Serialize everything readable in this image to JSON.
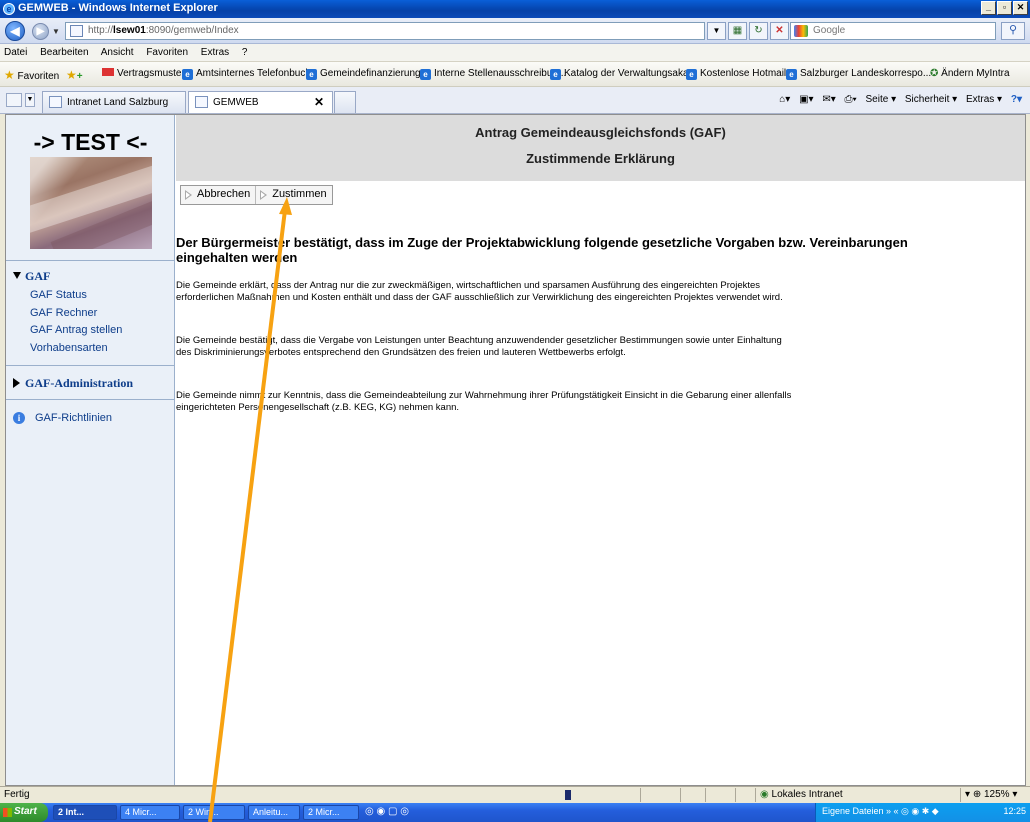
{
  "window": {
    "title": "GEMWEB - Windows Internet Explorer"
  },
  "address": {
    "url_prefix": "http://",
    "url_host": "lsew01",
    "url_rest": ":8090/gemweb/Index",
    "search_placeholder": "Google"
  },
  "menu": [
    "Datei",
    "Bearbeiten",
    "Ansicht",
    "Favoriten",
    "Extras",
    "?"
  ],
  "favorites": {
    "label": "Favoriten",
    "items": [
      "Vertragsmuster",
      "Amtsinternes Telefonbuch",
      "Gemeindefinanzierung",
      "Interne Stellenausschreibun...",
      "Katalog der Verwaltungsaka...",
      "Kostenlose Hotmail",
      "Salzburger Landeskorrespo...",
      "Ändern MyIntra"
    ]
  },
  "tabs": [
    {
      "label": "Intranet Land Salzburg"
    },
    {
      "label": "GEMWEB"
    }
  ],
  "tab_tools": [
    "Seite ▾",
    "Sicherheit ▾",
    "Extras ▾"
  ],
  "sidebar": {
    "logo_text": "-> TEST <-",
    "gaf_head": "GAF",
    "gaf_links": [
      "GAF Status",
      "GAF Rechner",
      "GAF Antrag stellen",
      "Vorhabensarten"
    ],
    "admin_head": "GAF-Administration",
    "guidelines": "GAF-Richtlinien"
  },
  "header": {
    "title": "Antrag Gemeindeausgleichsfonds (GAF)",
    "subtitle": "Zustimmende Erklärung"
  },
  "actions": {
    "cancel": "Abbrechen",
    "agree": "Zustimmen"
  },
  "main": {
    "heading": "Der Bürgermeister bestätigt, dass im Zuge der Projektabwicklung folgende gesetzliche Vorgaben bzw. Vereinbarungen eingehalten werden",
    "paragraphs": [
      "Die Gemeinde erklärt, dass der Antrag nur die zur zweckmäßigen, wirtschaftlichen und sparsamen Ausführung des eingereichten Projektes erforderlichen Maßnahmen und Kosten enthält und dass der GAF ausschließlich zur Verwirklichung des eingereichten Projektes verwendet wird.",
      "Die Gemeinde bestätigt, dass die Vergabe von Leistungen unter Beachtung anzuwendender gesetzlicher Bestimmungen sowie unter Einhaltung des Diskriminierungsverbotes entsprechend den Grundsätzen des freien und lauteren Wettbewerbs erfolgt.",
      "Die Gemeinde nimmt zur Kenntnis, dass die Gemeindeabteilung zur Wahrnehmung ihrer Prüfungstätigkeit Einsicht in die Gebarung einer allenfalls eingerichteten Personengesellschaft (z.B. KEG, KG) nehmen kann."
    ]
  },
  "status": {
    "text": "Fertig",
    "zone": "Lokales Intranet",
    "zoom": "125%"
  },
  "taskbar": {
    "start": "Start",
    "buttons": [
      "2 Int...",
      "4 Micr...",
      "2 Win...",
      "Anleitu...",
      "2 Micr..."
    ],
    "tray_text": "Eigene Dateien",
    "clock": "12:25"
  }
}
